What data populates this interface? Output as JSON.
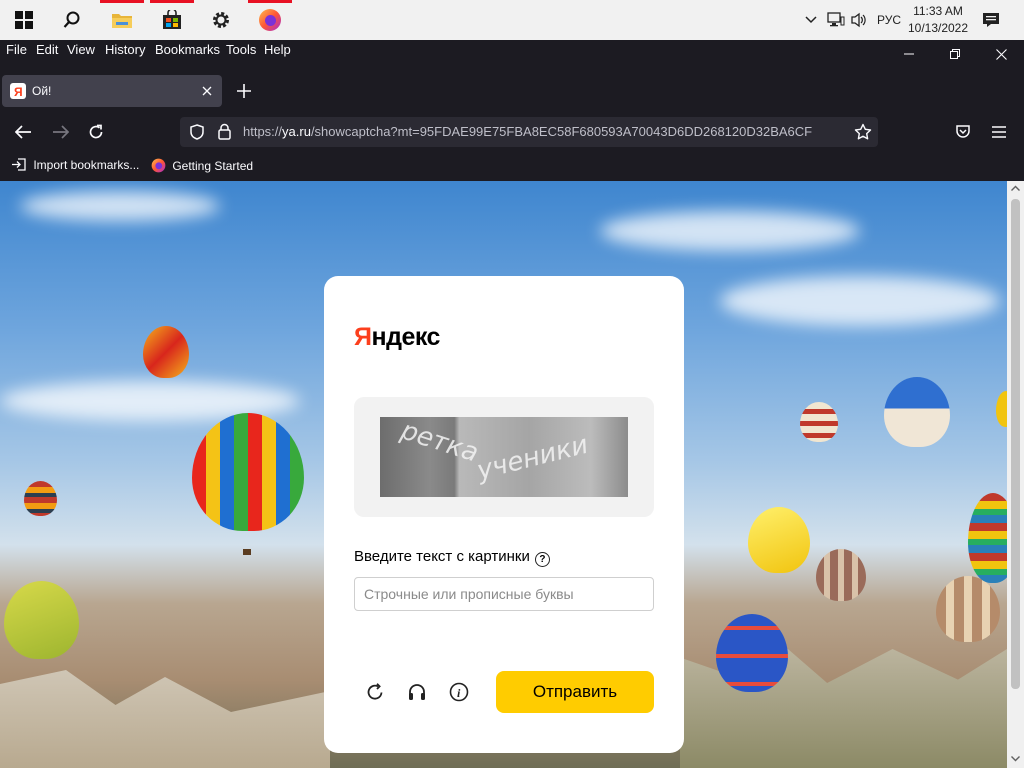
{
  "taskbar": {
    "clock_time": "11:33 AM",
    "clock_date": "10/13/2022",
    "language": "РУС",
    "icons": [
      "windows-start-icon",
      "search-icon",
      "file-explorer-icon",
      "microsoft-store-icon",
      "settings-icon",
      "firefox-icon"
    ],
    "tray_icons": [
      "chevron-up-icon",
      "network-icon",
      "volume-icon",
      "notifications-icon"
    ]
  },
  "menubar": {
    "items": [
      "File",
      "Edit",
      "View",
      "History",
      "Bookmarks",
      "Tools",
      "Help"
    ]
  },
  "tab": {
    "title": "Ой!"
  },
  "navbar": {
    "url_prefix": "https://",
    "url_host": "ya.ru",
    "url_path": "/showcaptcha?mt=95FDAE99E75FBA8EC58F680593A70043D6DD268120D32BA6CF"
  },
  "bookmarks": {
    "items": [
      "Import bookmarks...",
      "Getting Started"
    ]
  },
  "captcha": {
    "logo": "Яндекс",
    "captcha_words": [
      "ретка",
      "ученики"
    ],
    "prompt": "Введите текст с картинки",
    "help_symbol": "?",
    "input_placeholder": "Строчные или прописные буквы",
    "input_value": "",
    "submit_label": "Отправить",
    "colors": {
      "brand_red": "#fc3f1d",
      "button_yellow": "#ffcc00"
    }
  }
}
